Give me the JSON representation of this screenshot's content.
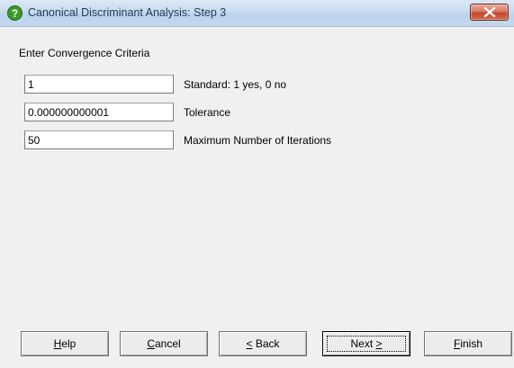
{
  "window": {
    "title": "Canonical Discriminant Analysis: Step 3"
  },
  "section": {
    "label": "Enter Convergence Criteria"
  },
  "fields": [
    {
      "value": "1",
      "label": "Standard: 1 yes, 0 no"
    },
    {
      "value": "0.000000000001",
      "label": "Tolerance"
    },
    {
      "value": "50",
      "label": "Maximum Number of Iterations"
    }
  ],
  "buttons": {
    "help": {
      "mnemonic": "H",
      "rest": "elp"
    },
    "cancel": {
      "mnemonic": "C",
      "rest": "ancel"
    },
    "back": {
      "mnemonic": "<",
      "rest": " Back"
    },
    "next": {
      "pre": "Next ",
      "mnemonic": ">"
    },
    "finish": {
      "mnemonic": "F",
      "rest": "inish"
    }
  },
  "colors": {
    "dialog_bg": "#f0f0f0",
    "title_text": "#1e395b",
    "close_button": "#c1472c",
    "help_icon": "#3a9a2a"
  },
  "icons": [
    "help-icon",
    "close-icon"
  ]
}
